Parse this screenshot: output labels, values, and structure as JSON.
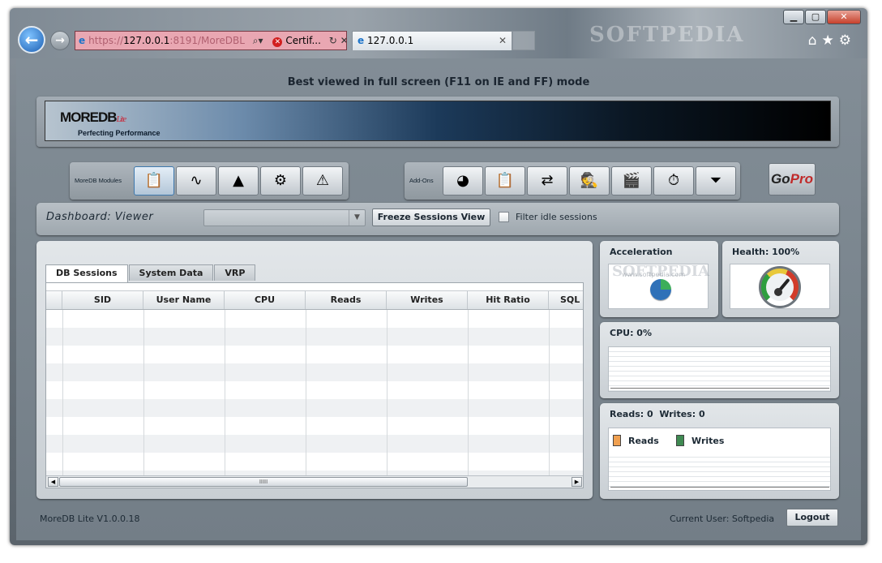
{
  "browser": {
    "address_host": "127.0.0.1",
    "address_rest": ":8191/MoreDBL",
    "address_prefix": "https://",
    "cert_label": "Certif...",
    "tab_title": "127.0.0.1",
    "watermark": "SOFTPEDIA"
  },
  "header": {
    "best_viewed": "Best viewed in full screen (F11 on IE and FF) mode",
    "logo_text": "MOREDB",
    "logo_lite": "Lite",
    "tagline": "Perfecting Performance"
  },
  "toolbar": {
    "modules_label": "MoreDB Modules",
    "addons_label": "Add-Ons",
    "modules_icons": [
      "dashboard-icon",
      "analysis-icon",
      "charts-icon",
      "settings-icon",
      "alert-icon"
    ],
    "addons_icons": [
      "pie-chart-icon",
      "clipboard-icon",
      "sync-icon",
      "spy-icon",
      "clapper-icon",
      "stopwatch-icon",
      "funnel-icon"
    ],
    "gopro_go": "Go",
    "gopro_pro": "Pro"
  },
  "dashboard": {
    "title": "Dashboard: Viewer",
    "freeze_button": "Freeze Sessions View",
    "filter_label": "Filter idle sessions"
  },
  "sessions": {
    "tabs": [
      "DB Sessions",
      "System Data",
      "VRP"
    ],
    "columns": [
      "SID",
      "User Name",
      "CPU",
      "Reads",
      "Writes",
      "Hit Ratio",
      "SQL T"
    ],
    "scroll_grip": "IIIII"
  },
  "side": {
    "acceleration_title": "Acceleration",
    "acceleration_watermark": "SOFTPEDIA",
    "acceleration_watermark_sub": "www.softpedia.com",
    "health_title": "Health: 100%",
    "cpu_title": "CPU: 0%",
    "io_title": "Reads: 0  Writes: 0",
    "legend": [
      {
        "label": "Reads",
        "color": "#f0a050"
      },
      {
        "label": "Writes",
        "color": "#3f8a52"
      }
    ]
  },
  "footer": {
    "version": "MoreDB Lite V1.0.0.18",
    "current_user": "Current User: Softpedia",
    "logout": "Logout"
  }
}
